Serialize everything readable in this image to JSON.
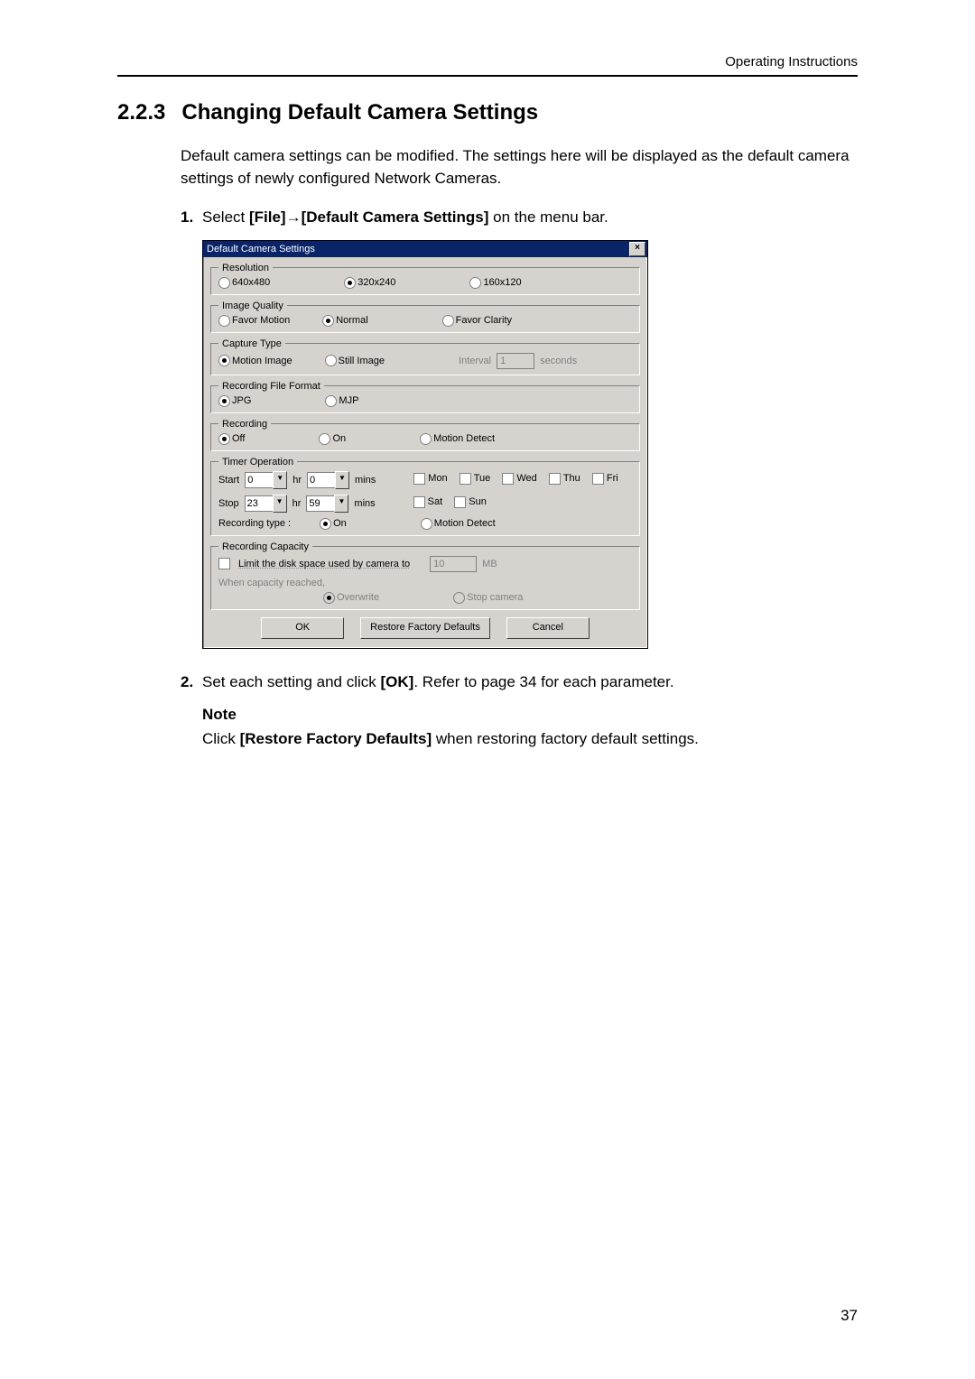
{
  "header": {
    "running": "Operating Instructions"
  },
  "section": {
    "num": "2.2.3",
    "title": "Changing Default Camera Settings"
  },
  "intro": "Default camera settings can be modified. The settings here will be displayed as the default camera settings of newly configured Network Cameras.",
  "step1": {
    "pre": "Select ",
    "file": "[File]",
    "arrow": " → ",
    "dest": "[Default Camera Settings]",
    "post": " on the menu bar."
  },
  "dialog": {
    "title": "Default Camera Settings",
    "close": "×",
    "groups": {
      "resolution": {
        "legend": "Resolution",
        "opts": [
          "640x480",
          "320x240",
          "160x120"
        ],
        "sel": 1
      },
      "quality": {
        "legend": "Image Quality",
        "opts": [
          "Favor Motion",
          "Normal",
          "Favor Clarity"
        ],
        "sel": 1
      },
      "capture": {
        "legend": "Capture Type",
        "opts": [
          "Motion Image",
          "Still Image"
        ],
        "sel": 0,
        "interval_lbl": "Interval",
        "interval_val": "1",
        "interval_unit": "seconds"
      },
      "format": {
        "legend": "Recording File Format",
        "opts": [
          "JPG",
          "MJP"
        ],
        "sel": 0
      },
      "recording": {
        "legend": "Recording",
        "opts": [
          "Off",
          "On",
          "Motion Detect"
        ],
        "sel": 0
      },
      "timer": {
        "legend": "Timer Operation",
        "start": "Start",
        "stop": "Stop",
        "hr": "hr",
        "mins": "mins",
        "start_h": "0",
        "start_m": "0",
        "stop_h": "23",
        "stop_m": "59",
        "days": [
          "Mon",
          "Tue",
          "Wed",
          "Thu",
          "Fri",
          "Sat",
          "Sun"
        ],
        "rec_type": "Recording type :",
        "rec_opts": [
          "On",
          "Motion Detect"
        ],
        "rec_sel": 0
      },
      "capacity": {
        "legend": "Recording Capacity",
        "limit": "Limit the disk space used by camera to",
        "val": "10",
        "unit": "MB",
        "when": "When capacity reached,",
        "opts": [
          "Overwrite",
          "Stop camera"
        ],
        "sel": 0
      }
    },
    "buttons": {
      "ok": "OK",
      "restore": "Restore Factory Defaults",
      "cancel": "Cancel"
    }
  },
  "step2": {
    "a": "Set each setting and click ",
    "ok": "[OK]",
    "b": ". Refer to page 34 for each parameter."
  },
  "note": {
    "label": "Note",
    "a": "Click ",
    "restore": "[Restore Factory Defaults]",
    "b": " when restoring factory default settings."
  },
  "page_number": "37"
}
